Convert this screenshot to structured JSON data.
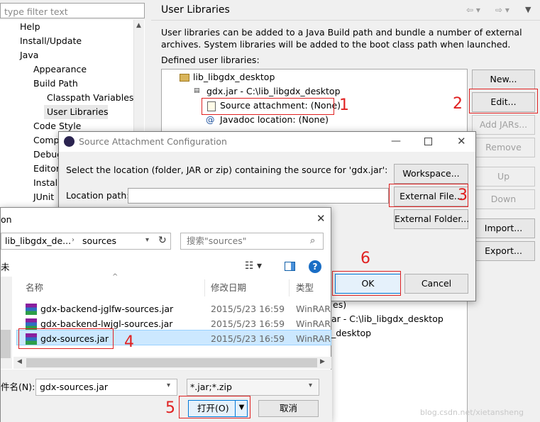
{
  "nav": {
    "filter_placeholder": "type filter text",
    "items": [
      "Help",
      "Install/Update",
      "Java",
      "Appearance",
      "Build Path",
      "Classpath Variables",
      "User Libraries",
      "Code Style",
      "Comp",
      "Debug",
      "Editor",
      "Install",
      "JUnit"
    ]
  },
  "panel": {
    "title": "User Libraries",
    "desc1": "User libraries can be added to a Java Build path and bundle a number of external",
    "desc2": "archives. System libraries will be added to the boot class path when launched.",
    "defined_label": "Defined user libraries:",
    "tree": [
      "lib_libgdx_desktop",
      "gdx.jar - C:\\lib_libgdx_desktop",
      "Source attachment: (None)",
      "Javadoc location: (None)"
    ],
    "tree_under": [
      "es)",
      "ar - C:\\lib_libgdx_desktop",
      "_desktop"
    ],
    "buttons": {
      "new": "New...",
      "edit": "Edit...",
      "add_jars": "Add JARs...",
      "remove": "Remove",
      "up": "Up",
      "down": "Down",
      "import": "Import...",
      "export": "Export..."
    }
  },
  "dialog1": {
    "title": "Source Attachment Configuration",
    "prompt": "Select the location (folder, JAR or zip) containing the source for 'gdx.jar':",
    "location_label": "Location path:",
    "location_value": "",
    "workspace": "Workspace...",
    "external_file": "External File...",
    "external_folder": "External Folder...",
    "ok": "OK",
    "cancel": "Cancel"
  },
  "dialog2": {
    "title_part": "on",
    "breadcrumb": [
      "lib_libgdx_de...",
      "sources"
    ],
    "search_placeholder": "搜索\"sources\"",
    "side_glyph": "未",
    "col_name": "名称",
    "col_date": "修改日期",
    "col_type": "类型",
    "files": [
      {
        "name": "gdx-backend-jglfw-sources.jar",
        "date": "2015/5/23 16:59",
        "type": "WinRAR"
      },
      {
        "name": "gdx-backend-lwjgl-sources.jar",
        "date": "2015/5/23 16:59",
        "type": "WinRAR"
      },
      {
        "name": "gdx-sources.jar",
        "date": "2015/5/23 16:59",
        "type": "WinRAR"
      }
    ],
    "filename_label": "件名(N):",
    "filename_value": "gdx-sources.jar",
    "filter_value": "*.jar;*.zip",
    "open": "打开(O)",
    "cancel": "取消"
  },
  "steps": [
    "1",
    "2",
    "3",
    "4",
    "5",
    "6"
  ],
  "watermark": "blog.csdn.net/xietansheng"
}
